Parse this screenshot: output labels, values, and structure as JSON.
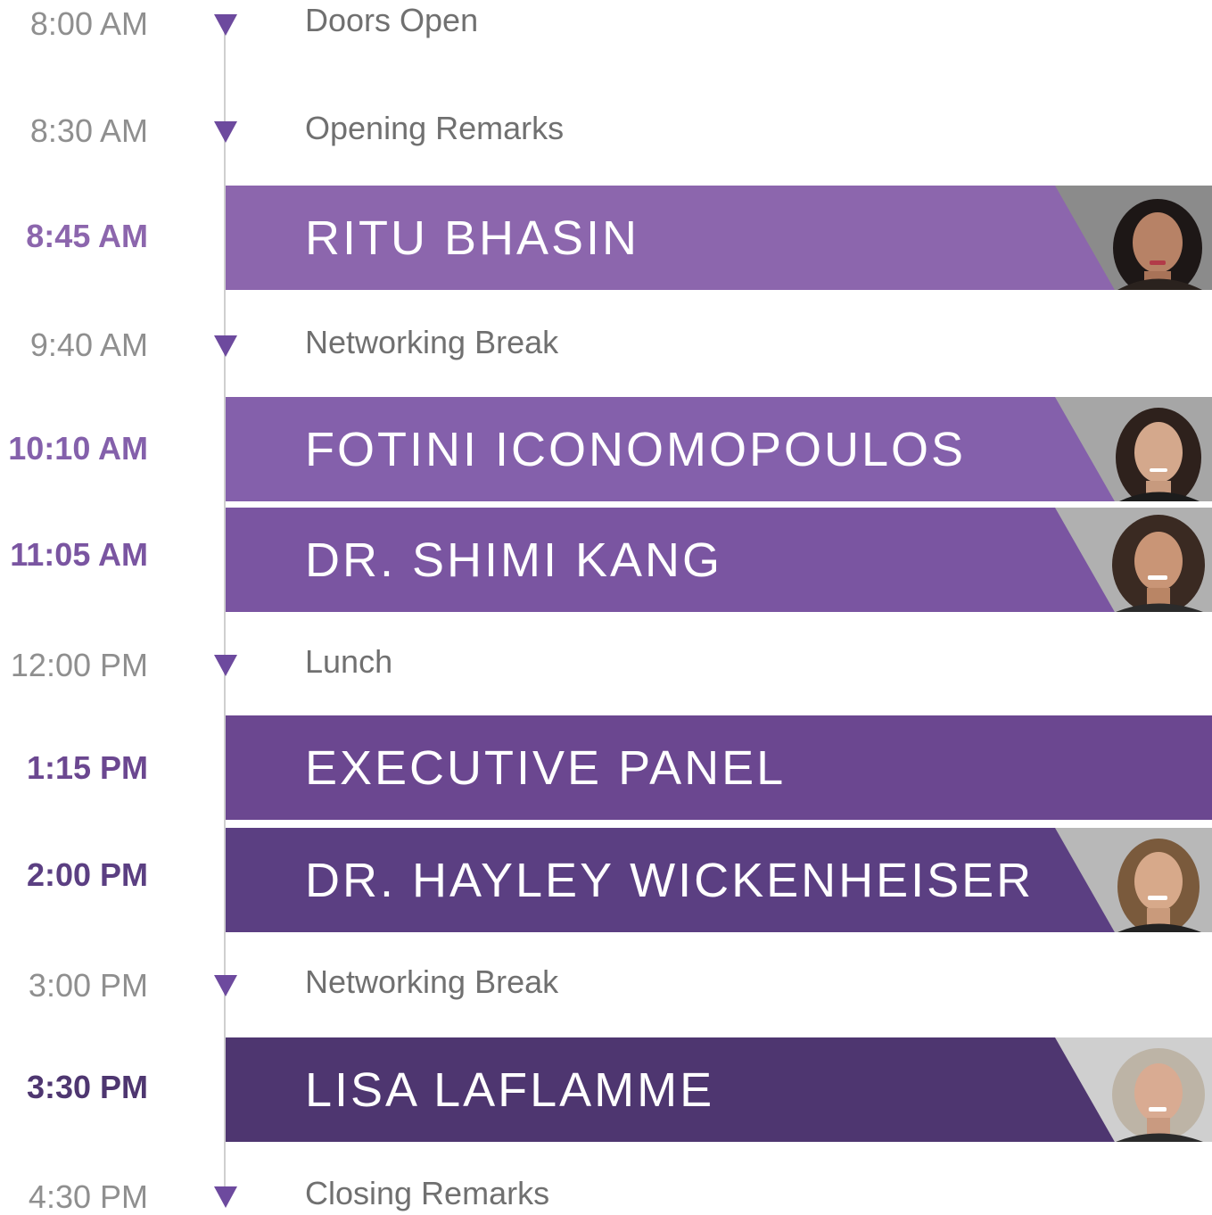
{
  "colors": {
    "band_1": "#8c66ad",
    "band_2": "#8460ab",
    "band_3": "#7a55a1",
    "band_4": "#6b4790",
    "band_5": "#5b3f82",
    "band_6": "#4e3670",
    "timeline": "#cfcfcf",
    "marker": "#6d4a9e",
    "light_text": "#8f8f8f"
  },
  "schedule": [
    {
      "time": "8:00 AM",
      "label": "Doors Open"
    },
    {
      "time": "8:30 AM",
      "label": "Opening Remarks"
    },
    {
      "time": "8:45 AM",
      "label": "RITU BHASIN",
      "photo": "speaker-photo"
    },
    {
      "time": "9:40 AM",
      "label": "Networking Break"
    },
    {
      "time": "10:10 AM",
      "label": "FOTINI ICONOMOPOULOS",
      "photo": "speaker-photo"
    },
    {
      "time": "11:05 AM",
      "label": "DR. SHIMI KANG",
      "photo": "speaker-photo"
    },
    {
      "time": "12:00 PM",
      "label": "Lunch"
    },
    {
      "time": "1:15 PM",
      "label": "EXECUTIVE PANEL"
    },
    {
      "time": "2:00 PM",
      "label": "DR. HAYLEY WICKENHEISER",
      "photo": "speaker-photo"
    },
    {
      "time": "3:00 PM",
      "label": "Networking Break"
    },
    {
      "time": "3:30 PM",
      "label": "LISA LAFLAMME",
      "photo": "speaker-photo"
    },
    {
      "time": "4:30 PM",
      "label": "Closing Remarks"
    }
  ]
}
